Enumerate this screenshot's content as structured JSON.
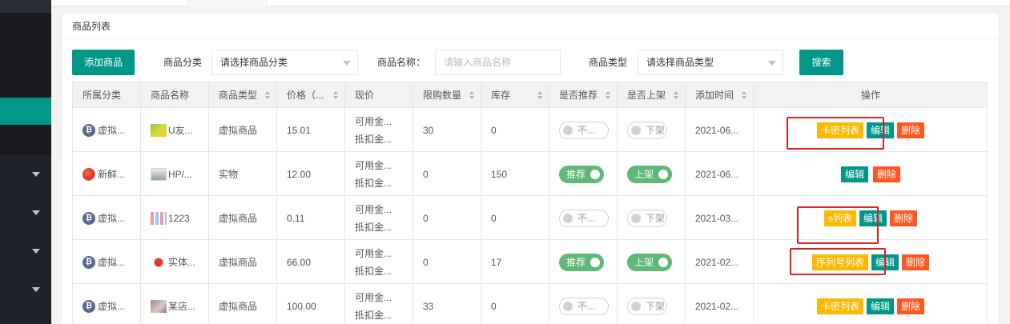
{
  "panel": {
    "title": "商品列表"
  },
  "toolbar": {
    "add_label": "添加商品",
    "category_label": "商品分类",
    "category_value": "请选择商品分类",
    "name_label": "商品名称：",
    "name_placeholder": "请输入商品名称",
    "type_label": "商品类型",
    "type_value": "请选择商品类型",
    "search_label": "搜索"
  },
  "table": {
    "headers": [
      "所属分类",
      "商品名称",
      "商品类型",
      "价格（...",
      "现价",
      "限购数量",
      "库存",
      "是否推荐",
      "是否上架",
      "添加时间",
      "操作"
    ],
    "rows": [
      {
        "category": "虚拟...",
        "category_icon": "bitcoin-icon",
        "name": "U友...",
        "type": "虚拟商品",
        "price": "15.01",
        "now1": "可用金...",
        "now2": "抵扣金...",
        "limit": "30",
        "stock": "0",
        "recommend": "不...",
        "recommend_on": false,
        "shelf": "下架",
        "shelf_on": false,
        "time": "2021-06...",
        "actions": [
          "卡密列表",
          "编辑",
          "删除"
        ]
      },
      {
        "category": "新鲜...",
        "category_icon": "fruit-icon",
        "name": "HP/...",
        "type": "实物",
        "price": "12.00",
        "now1": "可用金...",
        "now2": "抵扣金...",
        "limit": "0",
        "stock": "150",
        "recommend": "推荐",
        "recommend_on": true,
        "shelf": "上架",
        "shelf_on": true,
        "time": "2021-06...",
        "actions": [
          "编辑",
          "删除"
        ]
      },
      {
        "category": "虚拟...",
        "category_icon": "bitcoin-icon",
        "name": "1223",
        "type": "虚拟商品",
        "price": "0.11",
        "now1": "可用金...",
        "now2": "抵扣金...",
        "limit": "0",
        "stock": "0",
        "recommend": "不...",
        "recommend_on": false,
        "shelf": "下架",
        "shelf_on": false,
        "time": "2021-03...",
        "actions": [
          "s列表",
          "编辑",
          "删除"
        ]
      },
      {
        "category": "虚拟...",
        "category_icon": "bitcoin-icon",
        "name": "实体...",
        "type": "虚拟商品",
        "price": "66.00",
        "now1": "可用金...",
        "now2": "抵扣金...",
        "limit": "0",
        "stock": "17",
        "recommend": "推荐",
        "recommend_on": true,
        "shelf": "上架",
        "shelf_on": true,
        "time": "2021-02...",
        "actions": [
          "序列号列表",
          "编辑",
          "删除"
        ]
      },
      {
        "category": "虚拟...",
        "category_icon": "bitcoin-icon",
        "name": "某店...",
        "type": "虚拟商品",
        "price": "100.00",
        "now1": "可用金...",
        "now2": "抵扣金...",
        "limit": "33",
        "stock": "0",
        "recommend": "不...",
        "recommend_on": false,
        "shelf": "下架",
        "shelf_on": false,
        "time": "2021-02...",
        "actions": [
          "卡密列表",
          "编辑",
          "删除"
        ]
      }
    ]
  },
  "colors": {
    "primary": "#009688",
    "warn": "#ffb800",
    "danger": "#ff5722",
    "switch_on": "#5fb878",
    "sidebar": "#20222a",
    "annotation": "#e02020"
  }
}
